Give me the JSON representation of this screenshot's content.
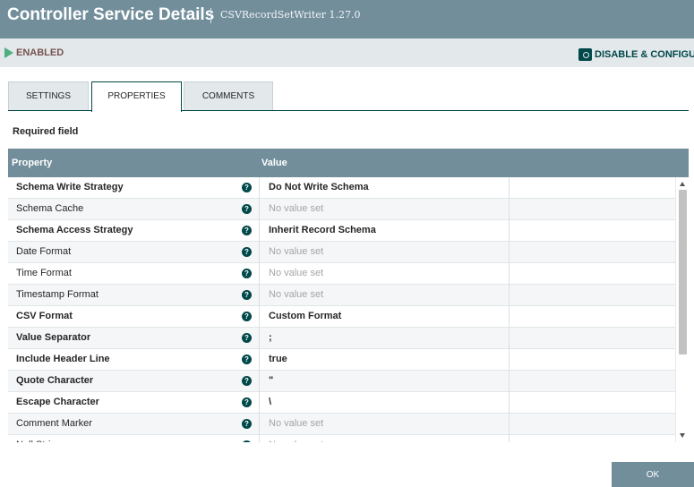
{
  "header": {
    "title": "Controller Service Details",
    "subtitle": "CSVRecordSetWriter 1.27.0"
  },
  "status": {
    "state": "ENABLED",
    "disable_label": "DISABLE & CONFIGUR"
  },
  "tabs": [
    {
      "label": "SETTINGS"
    },
    {
      "label": "PROPERTIES"
    },
    {
      "label": "COMMENTS"
    }
  ],
  "required_label": "Required field",
  "table": {
    "col_property": "Property",
    "col_value": "Value",
    "rows": [
      {
        "name": "Schema Write Strategy",
        "value": "Do Not Write Schema",
        "required": true,
        "set": true
      },
      {
        "name": "Schema Cache",
        "value": "No value set",
        "required": false,
        "set": false
      },
      {
        "name": "Schema Access Strategy",
        "value": "Inherit Record Schema",
        "required": true,
        "set": true
      },
      {
        "name": "Date Format",
        "value": "No value set",
        "required": false,
        "set": false
      },
      {
        "name": "Time Format",
        "value": "No value set",
        "required": false,
        "set": false
      },
      {
        "name": "Timestamp Format",
        "value": "No value set",
        "required": false,
        "set": false
      },
      {
        "name": "CSV Format",
        "value": "Custom Format",
        "required": true,
        "set": true
      },
      {
        "name": "Value Separator",
        "value": ";",
        "required": true,
        "set": true
      },
      {
        "name": "Include Header Line",
        "value": "true",
        "required": true,
        "set": true
      },
      {
        "name": "Quote Character",
        "value": "\"",
        "required": true,
        "set": true
      },
      {
        "name": "Escape Character",
        "value": "\\",
        "required": true,
        "set": true
      },
      {
        "name": "Comment Marker",
        "value": "No value set",
        "required": false,
        "set": false
      },
      {
        "name": "Null String",
        "value": "No value set",
        "required": false,
        "set": false
      }
    ]
  },
  "help_glyph": "?",
  "ok_label": "OK",
  "icons": [
    "play-icon",
    "gear-icon",
    "help-icon",
    "scroll-up-icon",
    "scroll-down-icon"
  ]
}
